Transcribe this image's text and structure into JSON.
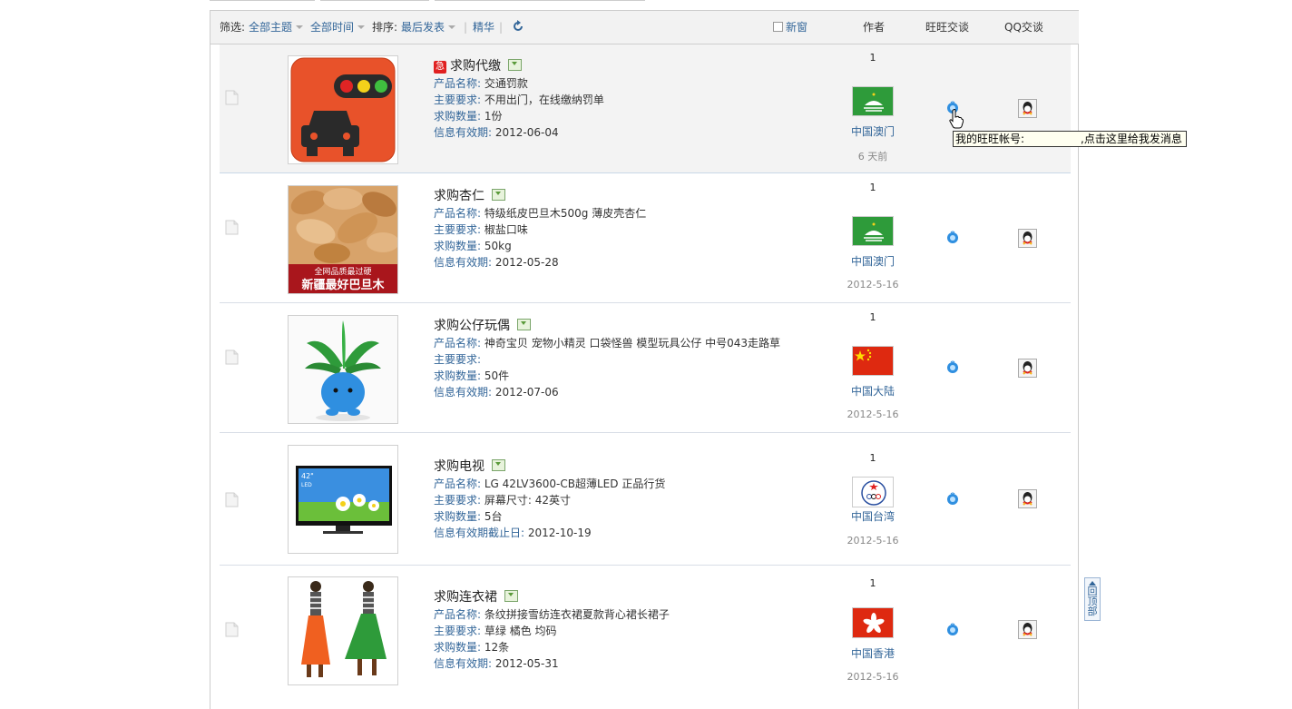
{
  "toolbar": {
    "filter_label": "筛选:",
    "filter_topic": "全部主题",
    "filter_time": "全部时间",
    "sort_label": "排序:",
    "sort_value": "最后发表",
    "digest": "精华",
    "new_window": "新窗"
  },
  "columns": {
    "author": "作者",
    "wangwang": "旺旺交谈",
    "qq": "QQ交谈"
  },
  "rows": [
    {
      "urgent": "急",
      "title": "求购代缴",
      "fields": [
        {
          "k": "产品名称:",
          "v": "交通罚款"
        },
        {
          "k": "主要要求:",
          "v": "不用出门，在线缴纳罚单"
        },
        {
          "k": "求购数量:",
          "v": "1份"
        },
        {
          "k": "信息有效期:",
          "v": "2012-06-04"
        }
      ],
      "count": "1",
      "region": "中国澳门",
      "date": "6 天前",
      "flag": "macau"
    },
    {
      "title": "求购杏仁",
      "fields": [
        {
          "k": "产品名称:",
          "v": "特级纸皮巴旦木500g 薄皮壳杏仁"
        },
        {
          "k": "主要要求:",
          "v": "椒盐口味"
        },
        {
          "k": "求购数量:",
          "v": "50kg"
        },
        {
          "k": "信息有效期:",
          "v": "2012-05-28"
        }
      ],
      "count": "1",
      "region": "中国澳门",
      "date": "2012-5-16",
      "flag": "macau",
      "thumb_text1": "全网品质最过硬",
      "thumb_text2": "新疆最好巴旦木"
    },
    {
      "title": "求购公仔玩偶",
      "fields": [
        {
          "k": "产品名称:",
          "v": "神奇宝贝 宠物小精灵 口袋怪兽 模型玩具公仔 中号043走路草"
        },
        {
          "k": "主要要求:",
          "v": ""
        },
        {
          "k": "求购数量:",
          "v": "50件"
        },
        {
          "k": "信息有效期:",
          "v": "2012-07-06"
        }
      ],
      "count": "1",
      "region": "中国大陆",
      "date": "2012-5-16",
      "flag": "china"
    },
    {
      "title": "求购电视",
      "fields": [
        {
          "k": "产品名称:",
          "v": "LG 42LV3600-CB超薄LED 正品行货"
        },
        {
          "k": "主要要求:",
          "v": "屏幕尺寸: 42英寸"
        },
        {
          "k": "求购数量:",
          "v": "5台"
        },
        {
          "k": "信息有效期截止日:",
          "v": "2012-10-19"
        }
      ],
      "count": "1",
      "region": "中国台湾",
      "date": "2012-5-16",
      "flag": "taipei",
      "thumb_text1": "42\"",
      "thumb_text2": "LED"
    },
    {
      "title": "求购连衣裙",
      "fields": [
        {
          "k": "产品名称:",
          "v": "条纹拼接雪纺连衣裙夏款背心裙长裙子"
        },
        {
          "k": "主要要求:",
          "v": "草绿 橘色 均码"
        },
        {
          "k": "求购数量:",
          "v": "12条"
        },
        {
          "k": "信息有效期:",
          "v": "2012-05-31"
        }
      ],
      "count": "1",
      "region": "中国香港",
      "date": "2012-5-16",
      "flag": "hongkong"
    }
  ],
  "tooltip": {
    "prefix": "我的旺旺帐号:",
    "suffix": ",点击这里给我发消息"
  },
  "back_to_top": {
    "line1": "回",
    "line2": "顶",
    "line3": "部"
  }
}
